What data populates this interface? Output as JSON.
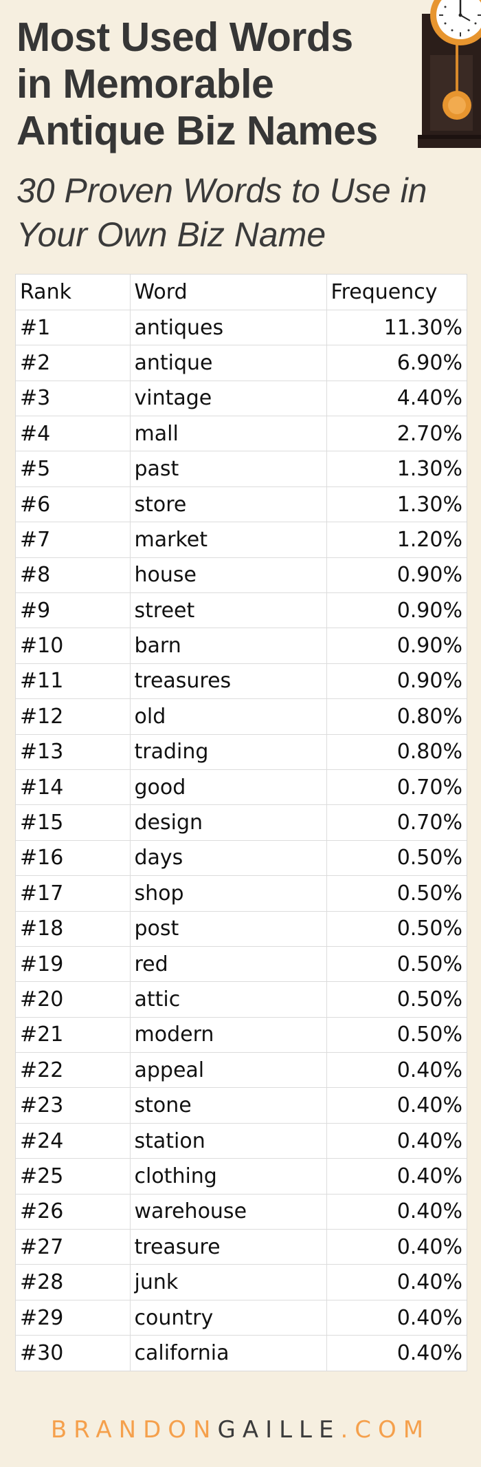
{
  "title": {
    "line1": "Most Used Words",
    "line2": "in Memorable",
    "line3": "Antique Biz Names"
  },
  "subtitle": {
    "line1": "30 Proven Words to Use in",
    "line2": "Your Own Biz Name"
  },
  "colors": {
    "background": "#f6efe0",
    "title": "#363636",
    "accent_orange": "#f5a04c",
    "clock_dark": "#2b1e1a"
  },
  "decoration": {
    "icon": "grandfather-clock-icon"
  },
  "table": {
    "headers": [
      "Rank",
      "Word",
      "Frequency"
    ],
    "rows": [
      [
        "#1",
        "antiques",
        "11.30%"
      ],
      [
        "#2",
        "antique",
        "6.90%"
      ],
      [
        "#3",
        "vintage",
        "4.40%"
      ],
      [
        "#4",
        "mall",
        "2.70%"
      ],
      [
        "#5",
        "past",
        "1.30%"
      ],
      [
        "#6",
        "store",
        "1.30%"
      ],
      [
        "#7",
        "market",
        "1.20%"
      ],
      [
        "#8",
        "house",
        "0.90%"
      ],
      [
        "#9",
        "street",
        "0.90%"
      ],
      [
        "#10",
        "barn",
        "0.90%"
      ],
      [
        "#11",
        "treasures",
        "0.90%"
      ],
      [
        "#12",
        "old",
        "0.80%"
      ],
      [
        "#13",
        "trading",
        "0.80%"
      ],
      [
        "#14",
        "good",
        "0.70%"
      ],
      [
        "#15",
        "design",
        "0.70%"
      ],
      [
        "#16",
        "days",
        "0.50%"
      ],
      [
        "#17",
        "shop",
        "0.50%"
      ],
      [
        "#18",
        "post",
        "0.50%"
      ],
      [
        "#19",
        "red",
        "0.50%"
      ],
      [
        "#20",
        "attic",
        "0.50%"
      ],
      [
        "#21",
        "modern",
        "0.50%"
      ],
      [
        "#22",
        "appeal",
        "0.40%"
      ],
      [
        "#23",
        "stone",
        "0.40%"
      ],
      [
        "#24",
        "station",
        "0.40%"
      ],
      [
        "#25",
        "clothing",
        "0.40%"
      ],
      [
        "#26",
        "warehouse",
        "0.40%"
      ],
      [
        "#27",
        "treasure",
        "0.40%"
      ],
      [
        "#28",
        "junk",
        "0.40%"
      ],
      [
        "#29",
        "country",
        "0.40%"
      ],
      [
        "#30",
        "california",
        "0.40%"
      ]
    ]
  },
  "footer": {
    "part1": "BRANDON",
    "part2": "GAILLE",
    "part3": ".COM"
  }
}
